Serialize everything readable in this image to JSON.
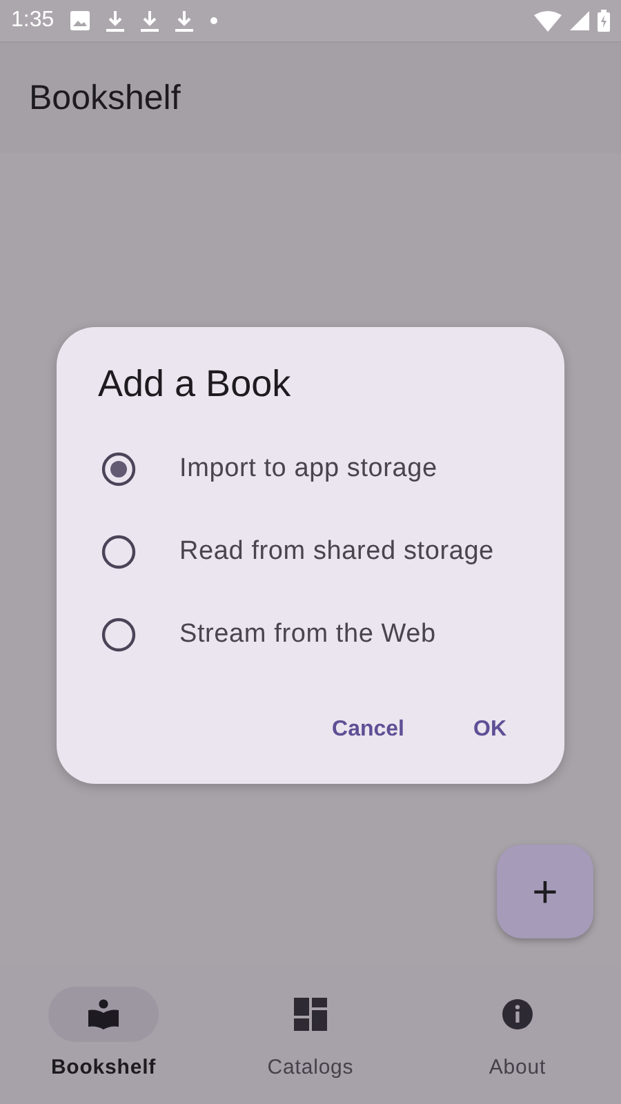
{
  "status_bar": {
    "time": "1:35"
  },
  "app_bar": {
    "title": "Bookshelf"
  },
  "dialog": {
    "title": "Add a Book",
    "options": [
      {
        "label": "Import to app storage",
        "selected": true
      },
      {
        "label": "Read from shared storage",
        "selected": false
      },
      {
        "label": "Stream from the Web",
        "selected": false
      }
    ],
    "buttons": [
      "Cancel",
      "OK"
    ]
  },
  "fab": {
    "label": "+"
  },
  "nav": [
    {
      "label": "Bookshelf",
      "selected": true
    },
    {
      "label": "Catalogs",
      "selected": false
    },
    {
      "label": "About",
      "selected": false
    }
  ]
}
